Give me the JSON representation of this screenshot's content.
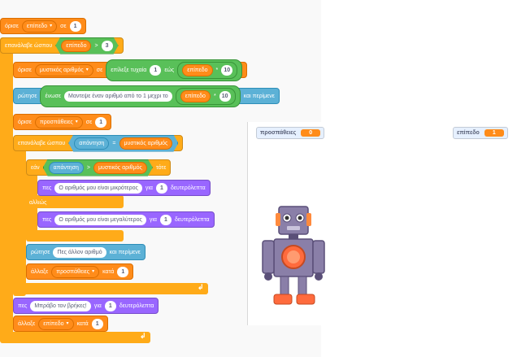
{
  "blocks": {
    "set_level": {
      "set": "όρισε",
      "var": "επίπεδο",
      "to": "σε",
      "value": "1"
    },
    "repeat_until_1": {
      "label": "επανάλαβε ώσπου",
      "var": "επίπεδο",
      "op": ">",
      "value": "3"
    },
    "set_secret": {
      "set": "όρισε",
      "var": "μυστικός αριθμός",
      "to": "σε",
      "random": "επίλεξε τυχαία",
      "from": "1",
      "upto": "εώς",
      "rvar": "επίπεδο",
      "op": "*",
      "mul": "10"
    },
    "ask": {
      "ask": "ρώτησε",
      "join": "ένωσε",
      "text": "Μαντεψε έναν αριθμό από το 1 μεχρι το",
      "var": "επίπεδο",
      "op": "*",
      "mul": "10",
      "wait": "και περίμενε"
    },
    "set_tries": {
      "set": "όρισε",
      "var": "προσπάθειες",
      "to": "σε",
      "value": "1"
    },
    "repeat_until_2": {
      "label": "επανάλαβε ώσπου",
      "left": "απάντηση",
      "op": "=",
      "right": "μυστικός αριθμός"
    },
    "if": {
      "if": "εάν",
      "left": "απάντηση",
      "op": ">",
      "right": "μυστικός αριθμός",
      "then": "τότε",
      "else": "αλλιώς"
    },
    "say_smaller": {
      "say": "πες",
      "text": "Ο αριθμός μου είναι μικρότερος",
      "for": "για",
      "secs": "1",
      "unit": "δευτερόλεπτα"
    },
    "say_bigger": {
      "say": "πες",
      "text": "Ο αριθμός μου είναι μεγαλύτερος",
      "for": "για",
      "secs": "1",
      "unit": "δευτερόλεπτα"
    },
    "ask_again": {
      "ask": "ρώτησε",
      "text": "Πες άλλον αριθμό",
      "wait": "και περίμενε"
    },
    "change_tries": {
      "change": "άλλαξε",
      "var": "προσπάθειες",
      "by": "κατά",
      "value": "1"
    },
    "say_found": {
      "say": "πες",
      "text": "Μπράβο τον βρήκες!",
      "for": "για",
      "secs": "1",
      "unit": "δευτερόλεπτα"
    },
    "change_level": {
      "change": "άλλαξε",
      "var": "επίπεδο",
      "by": "κατά",
      "value": "1"
    }
  },
  "monitors": {
    "tries": {
      "label": "προσπάθειες",
      "value": "0"
    },
    "level": {
      "label": "επίπεδο",
      "value": "1"
    }
  },
  "colors": {
    "variables": "#ff8c1a",
    "control": "#ffab19",
    "sensing": "#5cb1d6",
    "looks": "#9966ff",
    "operators": "#59c059"
  }
}
